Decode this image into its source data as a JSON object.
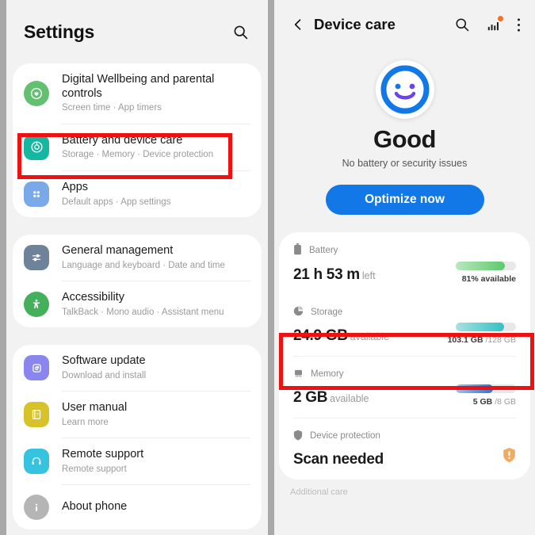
{
  "left_panel": {
    "header": {
      "title": "Settings",
      "search_icon": "search-icon"
    },
    "groups": [
      {
        "items": [
          {
            "title": "Digital Wellbeing and parental controls",
            "subtitle": "Screen time  ·  App timers",
            "icon": "wellbeing-heart-icon",
            "icon_color": "#63c071",
            "shape": "circle"
          },
          {
            "title": "Battery and device care",
            "subtitle": "Storage  ·  Memory  ·  Device protection",
            "icon": "battery-device-care-icon",
            "icon_color": "#14b8a0",
            "shape": "square",
            "highlighted": true
          },
          {
            "title": "Apps",
            "subtitle": "Default apps  ·  App settings",
            "icon": "apps-grid-icon",
            "icon_color": "#7aa9e9",
            "shape": "square"
          }
        ]
      },
      {
        "items": [
          {
            "title": "General management",
            "subtitle": "Language and keyboard  ·  Date and time",
            "icon": "sliders-icon",
            "icon_color": "#6e8299",
            "shape": "square"
          },
          {
            "title": "Accessibility",
            "subtitle": "TalkBack  ·  Mono audio  ·  Assistant menu",
            "icon": "accessibility-person-icon",
            "icon_color": "#44b05c",
            "shape": "circle"
          }
        ]
      },
      {
        "items": [
          {
            "title": "Software update",
            "subtitle": "Download and install",
            "icon": "software-update-icon",
            "icon_color": "#8b86ee",
            "shape": "square"
          },
          {
            "title": "User manual",
            "subtitle": "Learn more",
            "icon": "user-manual-icon",
            "icon_color": "#d8c22a",
            "shape": "square"
          },
          {
            "title": "Remote support",
            "subtitle": "Remote support",
            "icon": "headset-icon",
            "icon_color": "#35c3e0",
            "shape": "square"
          },
          {
            "title": "About phone",
            "subtitle": "",
            "icon": "info-icon",
            "icon_color": "#b5b5b5",
            "shape": "circle"
          }
        ]
      }
    ]
  },
  "right_panel": {
    "header": {
      "back_icon": "back-chevron-icon",
      "title": "Device care",
      "search_icon": "search-icon",
      "chart_icon": "bar-chart-icon",
      "chart_icon_badge_color": "#f07427",
      "more_icon": "more-vertical-icon"
    },
    "status": {
      "face_icon": "smiley-face-icon",
      "face_color": "#1278e8",
      "title": "Good",
      "subtitle": "No battery or security issues",
      "optimize_button": "Optimize now",
      "optimize_color": "#1278e8"
    },
    "rows": [
      {
        "label": "Battery",
        "icon": "battery-icon",
        "value": "21 h 53 m",
        "unit": "left",
        "bar_percent": 81,
        "bar_color_start": "#b9e8bd",
        "bar_color_end": "#5ec96c",
        "caption_bold": "81% available",
        "caption_rest": ""
      },
      {
        "label": "Storage",
        "icon": "storage-pie-icon",
        "value": "24.9 GB",
        "unit": "available",
        "bar_percent": 80,
        "bar_color_start": "#a6e2e0",
        "bar_color_end": "#30c2c6",
        "caption_bold": "103.1 GB",
        "caption_rest": " /128 GB",
        "highlighted": true
      },
      {
        "label": "Memory",
        "icon": "memory-chip-icon",
        "value": "2 GB",
        "unit": "available",
        "bar_percent": 62,
        "bar_color_start": "#9dc1ee",
        "bar_color_end": "#2f74d4",
        "caption_bold": "5 GB",
        "caption_rest": " /8 GB"
      },
      {
        "label": "Device protection",
        "icon": "shield-icon",
        "value": "Scan needed",
        "unit": "",
        "status_icon": "warning-shield-icon",
        "status_icon_color": "#f2aa5e"
      }
    ],
    "footer_text": "Additional care"
  },
  "highlight_color": "#ee1111"
}
